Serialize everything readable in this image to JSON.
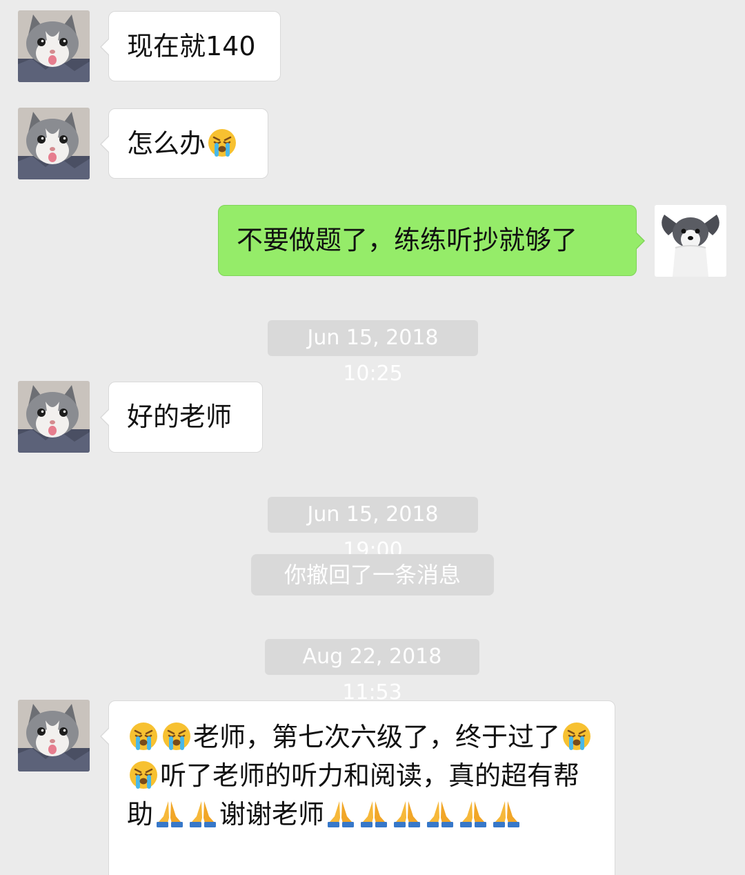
{
  "colors": {
    "background": "#ebebeb",
    "incoming_bubble": "#ffffff",
    "outgoing_bubble": "#95ec69",
    "system_pill": "#d9d9d9",
    "system_text": "#ffffff"
  },
  "messages": [
    {
      "side": "in",
      "avatar": "cat-avatar",
      "text": "现在就140"
    },
    {
      "side": "in",
      "avatar": "cat-avatar",
      "text_before_emoji": "怎么办",
      "emoji": [
        "crying-face-icon"
      ]
    },
    {
      "side": "out",
      "avatar": "dog-avatar",
      "text": "不要做题了，练练听抄就够了"
    },
    {
      "type": "timestamp",
      "text": "Jun 15, 2018 10:25"
    },
    {
      "side": "in",
      "avatar": "cat-avatar",
      "text": "好的老师"
    },
    {
      "type": "timestamp",
      "text": "Jun 15, 2018 19:00"
    },
    {
      "type": "system",
      "text": "你撤回了一条消息"
    },
    {
      "type": "timestamp",
      "text": "Aug 22, 2018 11:53"
    },
    {
      "side": "in",
      "avatar": "cat-avatar",
      "segments": [
        "老师，第七次六级了，终于过了",
        "听了老师的听力和阅读，真的超有帮助",
        "谢谢老师"
      ],
      "emoji": [
        "crying-face-icon",
        "folded-hands-icon"
      ]
    }
  ]
}
